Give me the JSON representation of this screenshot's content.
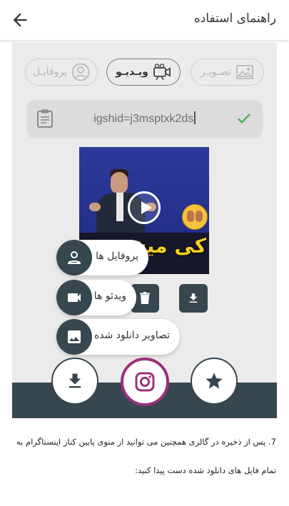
{
  "header": {
    "title": "راهنمای استفاده",
    "back_icon": "arrow-back-icon"
  },
  "tabs": [
    {
      "label": "تصـویـر",
      "icon": "image-icon",
      "active": false
    },
    {
      "label": "ویـدیـو",
      "icon": "video-camera-icon",
      "active": true
    },
    {
      "label": "پروفایـل",
      "icon": "profile-icon",
      "active": false
    }
  ],
  "url_input": {
    "value": "igshid=j3msptxk2ds",
    "clip_icon": "clipboard-icon",
    "check_icon": "check-icon"
  },
  "media": {
    "caption": "کی میخ",
    "play_icon": "play-icon"
  },
  "speed_dial": [
    {
      "label": "پروفایل ها",
      "icon": "person-icon"
    },
    {
      "label": "ویدئو ها",
      "icon": "videocam-icon"
    },
    {
      "label": "تصاویر دانلود شده",
      "icon": "image-icon"
    }
  ],
  "bottom_nav": [
    {
      "icon": "download-icon"
    },
    {
      "icon": "instagram-icon"
    },
    {
      "icon": "star-icon"
    }
  ],
  "description": {
    "line1": "7. پس از ذخیره در گالری همچنین می توانید از منوی پایین کنار اینستاگرام به",
    "line2": "تمام فایل های دانلود شده دست پیدا کنید:"
  },
  "colors": {
    "dark": "#37474f",
    "accent_check": "#4caf50",
    "instagram": "#9c2f7a",
    "panel": "#ebebeb"
  }
}
